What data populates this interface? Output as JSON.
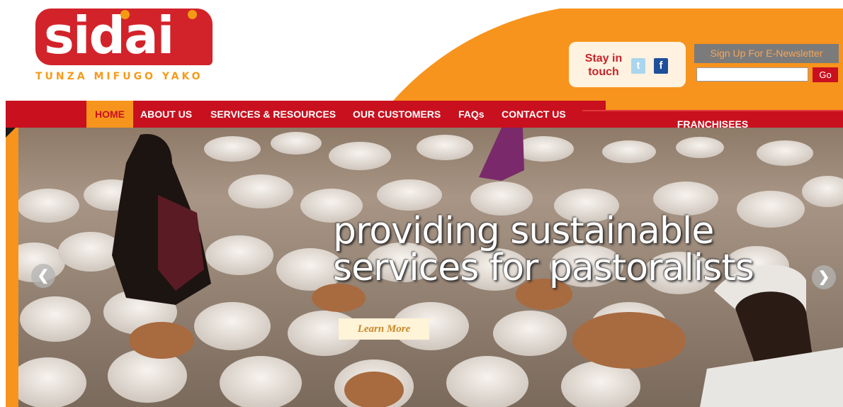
{
  "logo": {
    "word": "sidai",
    "tagline": "TUNZA MIFUGO YAKO"
  },
  "header": {
    "stay_in_touch": "Stay in touch",
    "social": {
      "twitter_glyph": "t",
      "facebook_glyph": "f"
    },
    "newsletter_label": "Sign Up For E-Newsletter",
    "newsletter_value": "",
    "go_label": "Go"
  },
  "nav": {
    "items": [
      {
        "label": "HOME",
        "active": true
      },
      {
        "label": "ABOUT US"
      },
      {
        "label": "SERVICES & RESOURCES"
      },
      {
        "label": "OUR CUSTOMERS"
      },
      {
        "label": "FAQs"
      },
      {
        "label": "CONTACT US"
      }
    ],
    "franchisees": "FRANCHISEES"
  },
  "hero": {
    "headline_line1": "providing sustainable",
    "headline_line2": "services for pastoralists",
    "cta": "Learn More",
    "prev_icon": "arrow-left-icon",
    "next_icon": "arrow-right-icon"
  },
  "colors": {
    "brand_red": "#c8101e",
    "brand_orange": "#f7941d"
  }
}
